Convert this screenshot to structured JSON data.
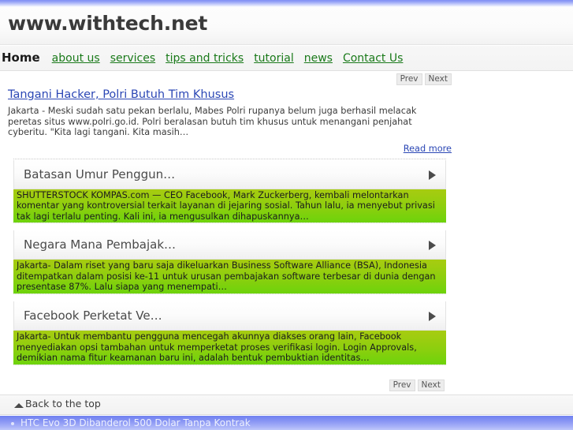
{
  "site": {
    "title": "www.withtech.net"
  },
  "nav": {
    "items": [
      {
        "label": "Home",
        "current": true
      },
      {
        "label": "about us",
        "current": false
      },
      {
        "label": "services",
        "current": false
      },
      {
        "label": "tips and tricks",
        "current": false
      },
      {
        "label": "tutorial",
        "current": false
      },
      {
        "label": "news",
        "current": false
      },
      {
        "label": "Contact Us",
        "current": false
      }
    ]
  },
  "pager": {
    "prev_label": "Prev",
    "next_label": "Next"
  },
  "featured": {
    "title": "Tangani Hacker, Polri Butuh Tim Khusus",
    "body": "Jakarta - Meski sudah satu pekan berlalu, Mabes Polri rupanya belum juga berhasil melacak peretas situs www.polri.go.id. Polri beralasan butuh tim khusus untuk menangani penjahat cyberitu. \"Kita lagi tangani. Kita masih…",
    "read_more_label": "Read more"
  },
  "accordion": {
    "panels": [
      {
        "title": "Batasan Umur Penggun…",
        "body": "SHUTTERSTOCK KOMPAS.com — CEO Facebook, Mark Zuckerberg, kembali melontarkan komentar yang kontroversial terkait layanan di jejaring sosial. Tahun lalu, ia menyebut privasi tak lagi terlalu penting. Kali ini, ia mengusulkan dihapuskannya…"
      },
      {
        "title": "Negara Mana Pembajak…",
        "body": "Jakarta- Dalam riset yang baru saja dikeluarkan Business Software Alliance (BSA), Indonesia ditempatkan dalam posisi ke-11 untuk urusan pembajakan software terbesar di dunia dengan presentase 87%. Lalu siapa yang menempati…"
      },
      {
        "title": "Facebook Perketat Ve…",
        "body": "Jakarta- Untuk membantu pengguna mencegah akunnya diakses orang lain, Facebook menyediakan opsi tambahan untuk memperketat proses verifikasi login. Login Approvals, demikian nama fitur keamanan baru ini, adalah bentuk pembuktian identitas…"
      }
    ]
  },
  "back_to_top": {
    "label": "Back to the top"
  },
  "footer": {
    "item_label": "HTC Evo 3D Dibanderol 500 Dolar Tanpa Kontrak"
  },
  "colors": {
    "accent_blue": "#7f8ff4",
    "link_blue": "#2b47b5",
    "nav_green": "#1a7a1a",
    "highlight_green_start": "#a6cc12",
    "highlight_green_end": "#6dd30b"
  }
}
